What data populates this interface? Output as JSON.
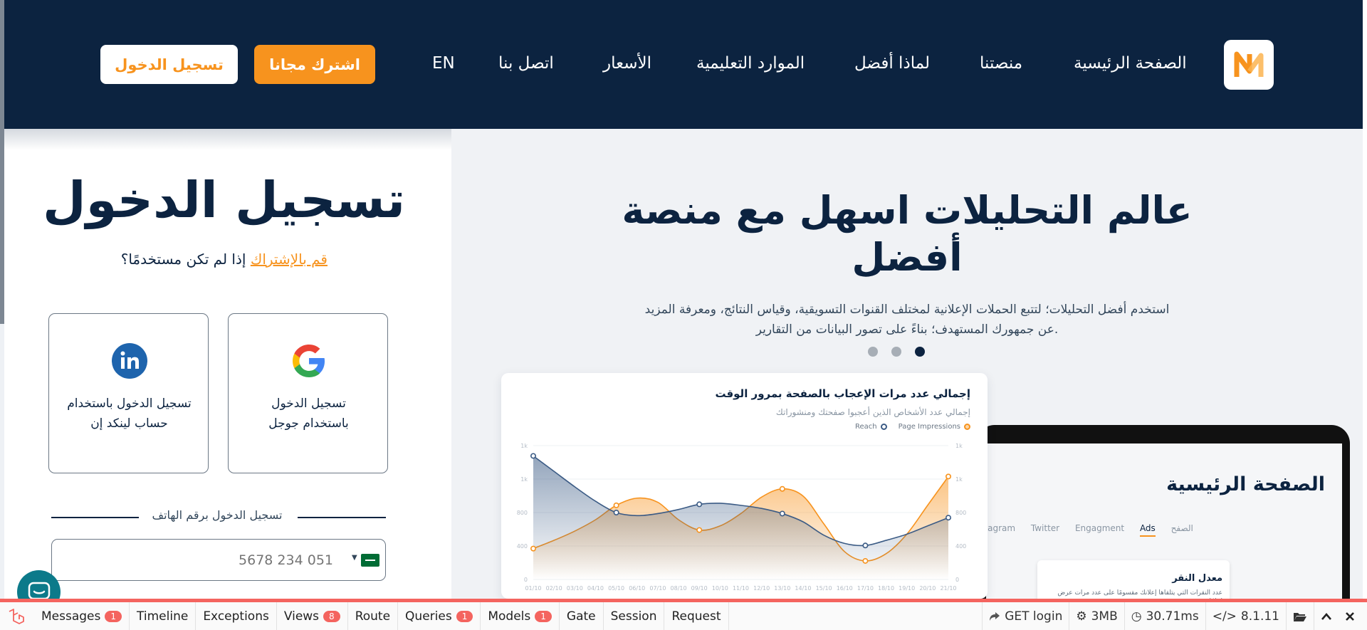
{
  "header": {
    "logo": "logo-icon",
    "nav": [
      {
        "label": "الصفحة الرئيسية"
      },
      {
        "label": "منصتنا"
      },
      {
        "label": "لماذا أفضل"
      },
      {
        "label": "الموارد التعليمية"
      },
      {
        "label": "الأسعار"
      },
      {
        "label": "اتصل بنا"
      },
      {
        "label": "EN"
      }
    ],
    "subscribe_label": "اشترك مجانا",
    "login_label": "تسجيل الدخول",
    "accent_color": "#f7931e",
    "bg_color": "#0c2340"
  },
  "hero": {
    "title_lines": [
      "عالم التحليلات اسهل مع منصة",
      "أفضل"
    ],
    "desc_lines": [
      "استخدم أفضل التحليلات؛ لتتبع الحملات الإعلانية لمختلف القنوات التسويقية، وقياس النتائج، ومعرفة المزيد",
      "عن جمهورك المستهدف؛ بناءً على تصور البيانات من التقارير."
    ],
    "slide_active": 3,
    "slide_count": 3,
    "chart_card": {
      "title": "إجمالي عدد مرات الإعجاب بالصفحة بمرور الوقت",
      "subtitle": "إجمالي عدد الأشخاص الذين أعجبوا صفحتك ومنشوراتك",
      "legend": [
        "Page Impressions",
        "Reach"
      ]
    },
    "laptop": {
      "title": "الصفحة الرئيسية",
      "tabs": [
        "الصفح",
        "Ads",
        "Engagment",
        "Twitter",
        "Instagram"
      ],
      "card_title": "معدل النقر",
      "card_text": "عدد النقرات التي يتلقاها إعلانك مقسومًا على عدد مرات عرض إعلانك"
    }
  },
  "chart_data": {
    "type": "area",
    "title": "إجمالي عدد مرات الإعجاب بالصفحة بمرور الوقت",
    "categories": [
      "21/10",
      "20/10",
      "19/10",
      "18/10",
      "17/10",
      "16/10",
      "15/10",
      "14/10",
      "13/10",
      "12/10",
      "11/10",
      "10/10",
      "09/10",
      "08/10",
      "07/10",
      "06/10",
      "05/10",
      "04/10",
      "03/10",
      "02/10",
      "01/10"
    ],
    "series": [
      {
        "name": "Page Impressions",
        "color": "#f7931e",
        "values": [
          1000,
          720,
          440,
          250,
          180,
          270,
          540,
          810,
          880,
          800,
          640,
          520,
          480,
          580,
          750,
          790,
          720,
          580,
          470,
          380,
          300
        ]
      },
      {
        "name": "Reach",
        "color": "#3b5b85",
        "values": [
          600,
          520,
          440,
          380,
          330,
          350,
          430,
          560,
          640,
          690,
          720,
          740,
          730,
          680,
          640,
          620,
          650,
          760,
          900,
          1050,
          1200
        ]
      }
    ],
    "left_ticks": [
      "1k",
      "1k",
      "800",
      "400",
      "0"
    ],
    "right_ticks": [
      "1k",
      "1k",
      "800",
      "400",
      "0"
    ],
    "legend_position": "top-right",
    "grid": true
  },
  "login": {
    "title": "تسجيل الدخول",
    "sub_prefix": "إذا لم تكن مستخدمًا؟",
    "sub_link": "قم بالإشتراك",
    "google_lines": [
      "تسجيل الدخول",
      "باستخدام جوجل"
    ],
    "linkedin_lines": [
      "تسجيل الدخول باستخدام",
      "حساب لينكد إن"
    ],
    "phone_divider": "تسجيل الدخول برقم الهاتف",
    "phone_placeholder": "5678 234 051",
    "flag": "saudi-flag-icon"
  },
  "debugbar": {
    "tabs": [
      {
        "label": "Messages",
        "badge": "1"
      },
      {
        "label": "Timeline",
        "badge": null
      },
      {
        "label": "Exceptions",
        "badge": null
      },
      {
        "label": "Views",
        "badge": "8"
      },
      {
        "label": "Route",
        "badge": null
      },
      {
        "label": "Queries",
        "badge": "1"
      },
      {
        "label": "Models",
        "badge": "1"
      },
      {
        "label": "Gate",
        "badge": null
      },
      {
        "label": "Session",
        "badge": null
      },
      {
        "label": "Request",
        "badge": null
      }
    ],
    "request": "GET login",
    "memory": "3MB",
    "time": "30.71ms",
    "php_version": "8.1.11",
    "accent": "#f4645f"
  }
}
